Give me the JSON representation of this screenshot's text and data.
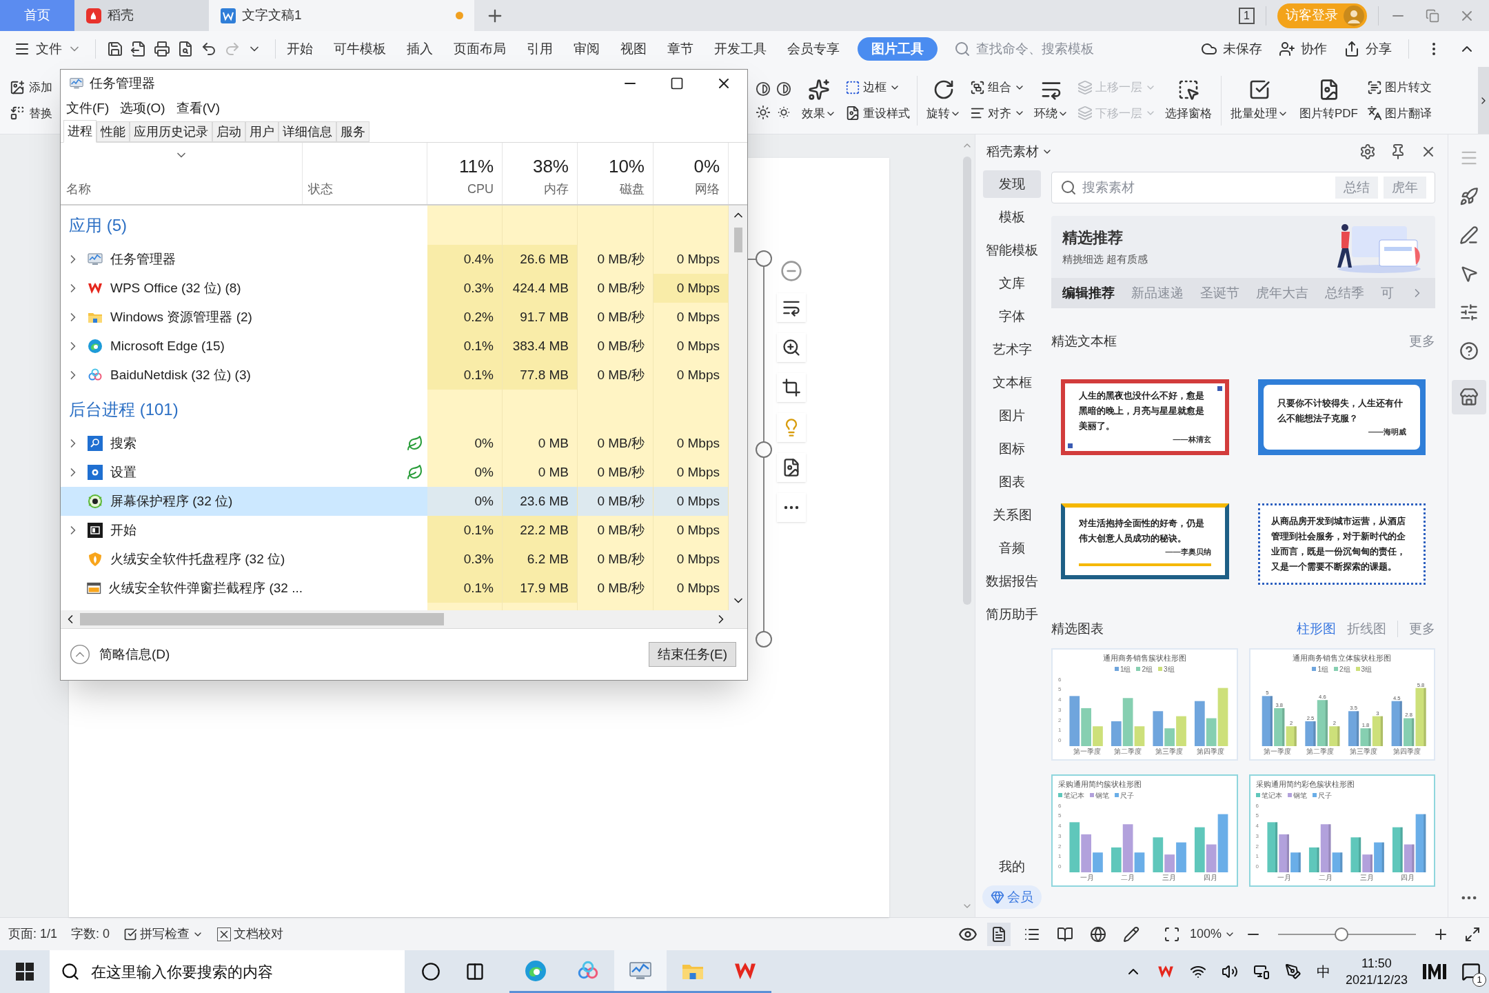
{
  "wps": {
    "tabs": [
      {
        "label": "首页",
        "kind": "home",
        "selected": false,
        "unsaved": false
      },
      {
        "label": "稻壳",
        "kind": "docer",
        "selected": false,
        "unsaved": false
      },
      {
        "label": "文字文稿1",
        "kind": "doc",
        "selected": true,
        "unsaved": true
      }
    ],
    "reading_badge": "1",
    "login": "访客登录",
    "menu": {
      "file": "文件",
      "tabs": [
        {
          "label": "开始",
          "selected": false
        },
        {
          "label": "可牛模板",
          "selected": false
        },
        {
          "label": "插入",
          "selected": false
        },
        {
          "label": "页面布局",
          "selected": false
        },
        {
          "label": "引用",
          "selected": false
        },
        {
          "label": "审阅",
          "selected": false
        },
        {
          "label": "视图",
          "selected": false
        },
        {
          "label": "章节",
          "selected": false
        },
        {
          "label": "开发工具",
          "selected": false
        },
        {
          "label": "会员专享",
          "selected": false
        },
        {
          "label": "图片工具",
          "selected": true
        }
      ],
      "search": {
        "placeholder": "查找命令、搜索模板"
      },
      "actions": [
        {
          "label": "未保存",
          "kind": "cloud"
        },
        {
          "label": "协作",
          "kind": "collab"
        },
        {
          "label": "分享",
          "kind": "share"
        }
      ]
    },
    "ribbon": {
      "left": [
        "添加",
        "替换"
      ],
      "items": [
        {
          "kind": "large",
          "label": "效果",
          "caret": true,
          "disabled": false
        },
        {
          "kind": "stack",
          "entries": [
            {
              "label": "边框",
              "caret": true,
              "disabled": false
            },
            {
              "label": "重设样式",
              "caret": false,
              "disabled": false
            }
          ]
        },
        {
          "kind": "divider"
        },
        {
          "kind": "large",
          "label": "旋转",
          "caret": true,
          "disabled": false
        },
        {
          "kind": "stack",
          "entries": [
            {
              "label": "组合",
              "caret": true,
              "disabled": false
            },
            {
              "label": "对齐",
              "caret": true,
              "disabled": false
            }
          ]
        },
        {
          "kind": "large",
          "label": "环绕",
          "caret": true,
          "disabled": false
        },
        {
          "kind": "stack",
          "entries": [
            {
              "label": "上移一层",
              "caret": true,
              "disabled": true
            },
            {
              "label": "下移一层",
              "caret": true,
              "disabled": true
            }
          ]
        },
        {
          "kind": "large",
          "label": "选择窗格",
          "caret": false,
          "disabled": false
        },
        {
          "kind": "divider"
        },
        {
          "kind": "large",
          "label": "批量处理",
          "caret": true,
          "disabled": false
        },
        {
          "kind": "large",
          "label": "图片转PDF",
          "caret": false,
          "disabled": false
        },
        {
          "kind": "stack",
          "entries": [
            {
              "label": "图片转文",
              "caret": false,
              "disabled": false
            },
            {
              "label": "图片翻译",
              "caret": false,
              "disabled": false
            }
          ]
        }
      ]
    }
  },
  "docer": {
    "title": "稻壳素材",
    "categories": [
      {
        "label": "发现",
        "selected": true
      },
      {
        "label": "模板",
        "selected": false
      },
      {
        "label": "智能模板",
        "selected": false
      },
      {
        "label": "文库",
        "selected": false
      },
      {
        "label": "字体",
        "selected": false
      },
      {
        "label": "艺术字",
        "selected": false
      },
      {
        "label": "文本框",
        "selected": false
      },
      {
        "label": "图片",
        "selected": false
      },
      {
        "label": "图标",
        "selected": false
      },
      {
        "label": "图表",
        "selected": false
      },
      {
        "label": "关系图",
        "selected": false
      },
      {
        "label": "音频",
        "selected": false
      },
      {
        "label": "数据报告",
        "selected": false
      },
      {
        "label": "简历助手",
        "selected": false
      }
    ],
    "bottom": [
      {
        "label": "我的",
        "kind": "mine"
      },
      {
        "label": "会员",
        "kind": "vip"
      }
    ],
    "search": {
      "placeholder": "搜索素材",
      "tags": [
        "总结",
        "虎年"
      ]
    },
    "banner": {
      "title": "精选推荐",
      "subtitle": "精挑细选 超有质感",
      "tabs": [
        {
          "label": "编辑推荐",
          "selected": true
        },
        {
          "label": "新品速递",
          "selected": false
        },
        {
          "label": "圣诞节",
          "selected": false
        },
        {
          "label": "虎年大吉",
          "selected": false
        },
        {
          "label": "总结季",
          "selected": false
        },
        {
          "label": "可",
          "selected": false
        }
      ]
    },
    "textboxes": {
      "title": "精选文本框",
      "more": "更多",
      "cards": [
        {
          "kind": "classic",
          "quote": "人生的黑夜也没什么不好，愈是黑暗的晚上，月亮与星星就愈是美丽了。",
          "author": "——林清玄"
        },
        {
          "kind": "bubble",
          "quote": "只要你不计较得失，人生还有什么不能想法子克服？",
          "author": "——海明威"
        },
        {
          "kind": "accent",
          "quote": "对生活抱持全面性的好奇，仍是伟大创意人员成功的秘诀。",
          "author": "——李奥贝纳"
        },
        {
          "kind": "dotted",
          "quote": "从商品房开发到城市运营，从酒店管理到社会服务，对于新时代的企业而言，既是一份沉甸甸的责任，又是一个需要不断探索的课题。"
        }
      ]
    },
    "charts": {
      "title": "精选图表",
      "filters": [
        {
          "label": "柱形图",
          "selected": true
        },
        {
          "label": "折线图",
          "selected": false
        }
      ],
      "more": "更多",
      "items": [
        {
          "kind": "flat",
          "title": "通用商务销售簇状柱形图",
          "legend": [
            "1组",
            "2组",
            "3组"
          ],
          "categories": [
            "第一季度",
            "第二季度",
            "第三季度",
            "第四季度"
          ],
          "yticks": [
            "6",
            "5",
            "4",
            "3",
            "2",
            "1",
            "0"
          ]
        },
        {
          "kind": "solid",
          "title": "通用商务销售立体簇状柱形图",
          "legend": [
            "1组",
            "2组",
            "3组"
          ],
          "categories": [
            "第一季度",
            "第二季度",
            "第三季度",
            "第四季度"
          ],
          "value_labels": [
            "5",
            "3.8",
            "2",
            "2.5",
            "4.6",
            "2",
            "3.5",
            "1.8",
            "3",
            "4.5",
            "2.8",
            "5.8"
          ]
        },
        {
          "kind": "flat",
          "title": "采购通用简约簇状柱形图",
          "legend": [
            "笔记本",
            "钢笔",
            "尺子"
          ],
          "categories": [
            "一月",
            "二月",
            "三月",
            "四月"
          ],
          "yticks": [
            "6",
            "5",
            "4",
            "3",
            "2",
            "1",
            "0"
          ]
        },
        {
          "kind": "solid",
          "title": "采购通用简约彩色簇状柱形图",
          "legend": [
            "笔记本",
            "钢笔",
            "尺子"
          ],
          "categories": [
            "一月",
            "二月",
            "三月",
            "四月"
          ],
          "yticks": [
            "6",
            "5",
            "4",
            "3",
            "2",
            "1",
            "0"
          ]
        }
      ]
    }
  },
  "status_bar": {
    "page": "页面: 1/1",
    "words": "字数: 0",
    "spell": "拼写检查",
    "proof": "文档校对",
    "views": [
      {
        "kind": "page",
        "selected": true
      },
      {
        "kind": "outline",
        "selected": false
      },
      {
        "kind": "read",
        "selected": false
      },
      {
        "kind": "web",
        "selected": false
      },
      {
        "kind": "write",
        "selected": false
      }
    ],
    "zoom": {
      "reading": "100%",
      "level": 0.46
    }
  },
  "taskbar": {
    "search_placeholder": "在这里输入你要搜索的内容",
    "apps": [
      {
        "kind": "edge",
        "selected": false
      },
      {
        "kind": "baidu",
        "selected": false
      },
      {
        "kind": "taskmgr",
        "selected": true
      },
      {
        "kind": "explorer",
        "selected": false
      },
      {
        "kind": "wps",
        "selected": false
      }
    ],
    "ime": "中",
    "time": "11:50",
    "date": "2021/12/23",
    "notifications": "1"
  },
  "task_manager": {
    "title": "任务管理器",
    "menu": [
      "文件(F)",
      "选项(O)",
      "查看(V)"
    ],
    "tabs": [
      {
        "label": "进程",
        "selected": true
      },
      {
        "label": "性能",
        "selected": false
      },
      {
        "label": "应用历史记录",
        "selected": false
      },
      {
        "label": "启动",
        "selected": false
      },
      {
        "label": "用户",
        "selected": false
      },
      {
        "label": "详细信息",
        "selected": false
      },
      {
        "label": "服务",
        "selected": false
      }
    ],
    "columns": {
      "name": "名称",
      "status": "状态",
      "metrics": [
        {
          "percent": "11%",
          "label": "CPU"
        },
        {
          "percent": "38%",
          "label": "内存"
        },
        {
          "percent": "10%",
          "label": "磁盘"
        },
        {
          "percent": "0%",
          "label": "网络"
        }
      ]
    },
    "groups": [
      {
        "title": "应用 (5)",
        "rows": [
          {
            "name": "任务管理器",
            "kind": "taskmgr",
            "expandable": true,
            "selected": false,
            "efficiency": false,
            "values": [
              {
                "text": "0.4%",
                "color": "#f9eca8"
              },
              {
                "text": "26.6 MB",
                "color": "#f9eca8"
              },
              {
                "text": "0 MB/秒",
                "color": "#fff4c4"
              },
              {
                "text": "0 Mbps",
                "color": "#fff4c4"
              }
            ]
          },
          {
            "name": "WPS Office (32 位) (8)",
            "kind": "wps",
            "expandable": true,
            "selected": false,
            "efficiency": false,
            "values": [
              {
                "text": "0.3%",
                "color": "#f9eca8"
              },
              {
                "text": "424.4 MB",
                "color": "#f9eca8"
              },
              {
                "text": "0 MB/秒",
                "color": "#fff4c4"
              },
              {
                "text": "0 Mbps",
                "color": "#f9eca8"
              }
            ]
          },
          {
            "name": "Windows 资源管理器 (2)",
            "kind": "explorer",
            "expandable": true,
            "selected": false,
            "efficiency": false,
            "values": [
              {
                "text": "0.2%",
                "color": "#f9eca8"
              },
              {
                "text": "91.7 MB",
                "color": "#f9eca8"
              },
              {
                "text": "0 MB/秒",
                "color": "#fff4c4"
              },
              {
                "text": "0 Mbps",
                "color": "#fff4c4"
              }
            ]
          },
          {
            "name": "Microsoft Edge (15)",
            "kind": "edge",
            "expandable": true,
            "selected": false,
            "efficiency": false,
            "values": [
              {
                "text": "0.1%",
                "color": "#f9eca8"
              },
              {
                "text": "383.4 MB",
                "color": "#f9eca8"
              },
              {
                "text": "0 MB/秒",
                "color": "#fff4c4"
              },
              {
                "text": "0 Mbps",
                "color": "#fff4c4"
              }
            ]
          },
          {
            "name": "BaiduNetdisk (32 位) (3)",
            "kind": "baidu",
            "expandable": true,
            "selected": false,
            "efficiency": false,
            "values": [
              {
                "text": "0.1%",
                "color": "#f9eca8"
              },
              {
                "text": "77.8 MB",
                "color": "#f9eca8"
              },
              {
                "text": "0 MB/秒",
                "color": "#fff4c4"
              },
              {
                "text": "0 Mbps",
                "color": "#fff4c4"
              }
            ]
          }
        ]
      },
      {
        "title": "后台进程 (101)",
        "rows": [
          {
            "name": "搜索",
            "kind": "search",
            "expandable": true,
            "selected": false,
            "efficiency": true,
            "values": [
              {
                "text": "0%",
                "color": "#fff4c4"
              },
              {
                "text": "0 MB",
                "color": "#fff4c4"
              },
              {
                "text": "0 MB/秒",
                "color": "#fff4c4"
              },
              {
                "text": "0 Mbps",
                "color": "#fff4c4"
              }
            ]
          },
          {
            "name": "设置",
            "kind": "settings",
            "expandable": true,
            "selected": false,
            "efficiency": true,
            "values": [
              {
                "text": "0%",
                "color": "#fff4c4"
              },
              {
                "text": "0 MB",
                "color": "#fff4c4"
              },
              {
                "text": "0 MB/秒",
                "color": "#fff4c4"
              },
              {
                "text": "0 Mbps",
                "color": "#fff4c4"
              }
            ]
          },
          {
            "name": "屏幕保护程序 (32 位)",
            "kind": "screensaver",
            "expandable": false,
            "selected": true,
            "efficiency": false,
            "values": [
              {
                "text": "0%",
                "color": "#dde9ef"
              },
              {
                "text": "23.6 MB",
                "color": "#d3e6f1"
              },
              {
                "text": "0 MB/秒",
                "color": "#dde9ef"
              },
              {
                "text": "0 Mbps",
                "color": "#dde9ef"
              }
            ]
          },
          {
            "name": "开始",
            "kind": "start",
            "expandable": true,
            "selected": false,
            "efficiency": false,
            "values": [
              {
                "text": "0.1%",
                "color": "#f9eca8"
              },
              {
                "text": "22.2 MB",
                "color": "#f9eca8"
              },
              {
                "text": "0 MB/秒",
                "color": "#fff4c4"
              },
              {
                "text": "0 Mbps",
                "color": "#fff4c4"
              }
            ]
          },
          {
            "name": "火绒安全软件托盘程序 (32 位)",
            "kind": "shield",
            "expandable": false,
            "selected": false,
            "efficiency": false,
            "values": [
              {
                "text": "0.3%",
                "color": "#f9eca8"
              },
              {
                "text": "6.2 MB",
                "color": "#f9eca8"
              },
              {
                "text": "0 MB/秒",
                "color": "#fff4c4"
              },
              {
                "text": "0 Mbps",
                "color": "#fff4c4"
              }
            ]
          },
          {
            "name": "火绒安全软件弹窗拦截程序 (32 ...",
            "kind": "popup",
            "expandable": false,
            "selected": false,
            "efficiency": false,
            "values": [
              {
                "text": "0.1%",
                "color": "#f9eca8"
              },
              {
                "text": "17.9 MB",
                "color": "#f9eca8"
              },
              {
                "text": "0 MB/秒",
                "color": "#fff4c4"
              },
              {
                "text": "0 Mbps",
                "color": "#fff4c4"
              }
            ]
          }
        ]
      }
    ],
    "footer": {
      "details": "简略信息(D)",
      "end_task": "结束任务(E)"
    }
  }
}
